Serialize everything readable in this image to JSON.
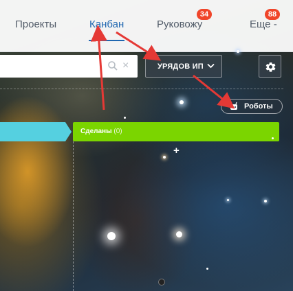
{
  "nav": {
    "items": [
      {
        "label": "Проекты"
      },
      {
        "label": "Канбан"
      },
      {
        "label": "Руковожу",
        "badge": "34"
      },
      {
        "label": "Еще -",
        "badge": "88"
      }
    ],
    "active": "Канбан"
  },
  "search": {
    "placeholder": "",
    "clear_icon": "×",
    "search_icon": "magnifier-icon"
  },
  "filter": {
    "label": "УРЯДОВ ИП",
    "chevron": "chevron-down-icon"
  },
  "settings": {
    "icon": "gear-icon"
  },
  "robots": {
    "label": "Роботы",
    "icon": "robot-icon"
  },
  "stages": [
    {
      "name": "",
      "color": "#55d0e0"
    },
    {
      "name": "Сделаны",
      "count": "(0)",
      "color": "#7bd500"
    }
  ],
  "add_icon": "+",
  "colors": {
    "accent": "#2067b0",
    "badge": "#f0452a",
    "arrow": "#e53935"
  }
}
